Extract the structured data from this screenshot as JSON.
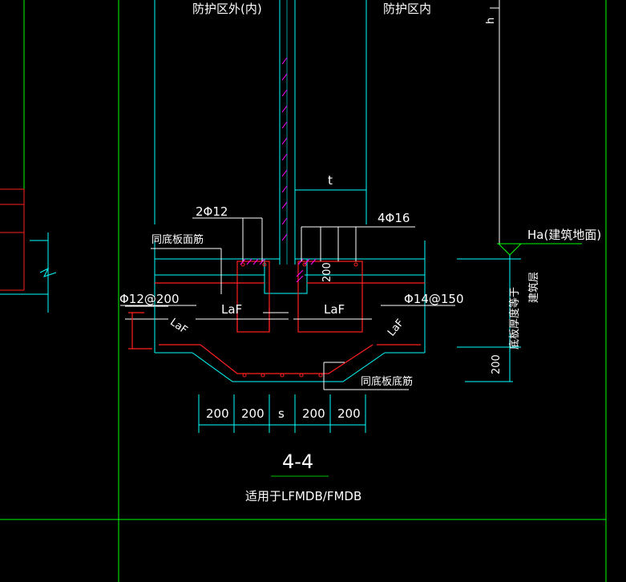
{
  "drawing": {
    "label_outside": "防护区外(内)",
    "label_inside": "防护区内",
    "height_symbol": "h",
    "wall_thickness_symbol": "t",
    "top_bars_left": "2Φ12",
    "top_bars_right": "4Φ16",
    "same_as_top_bars": "同底板面筋",
    "stirrup_left": "Φ12@200",
    "stirrup_right": "Φ14@150",
    "anchor_label": "LaF",
    "anchor_label_slanted": "LaF",
    "dim_200_vertical": "200",
    "ground_level": "Ha(建筑地面)",
    "building_layer": "建筑层",
    "slab_thickness_note": "底板厚度等于",
    "dim_right_vertical": "200",
    "same_as_bottom_bars": "同底板底筋",
    "bottom_dims": [
      "200",
      "200",
      "s",
      "200",
      "200"
    ],
    "section_title": "4-4",
    "applies_to": "适用于LFMDB/FMDB"
  },
  "colors": {
    "background": "#000000",
    "frame": "#00ff00",
    "concrete": "#00ffff",
    "rebar": "#ff2020",
    "dimension": "#ffffff",
    "text": "#ffffff",
    "hatch": "#ff00ff",
    "underline": "#00c000"
  }
}
